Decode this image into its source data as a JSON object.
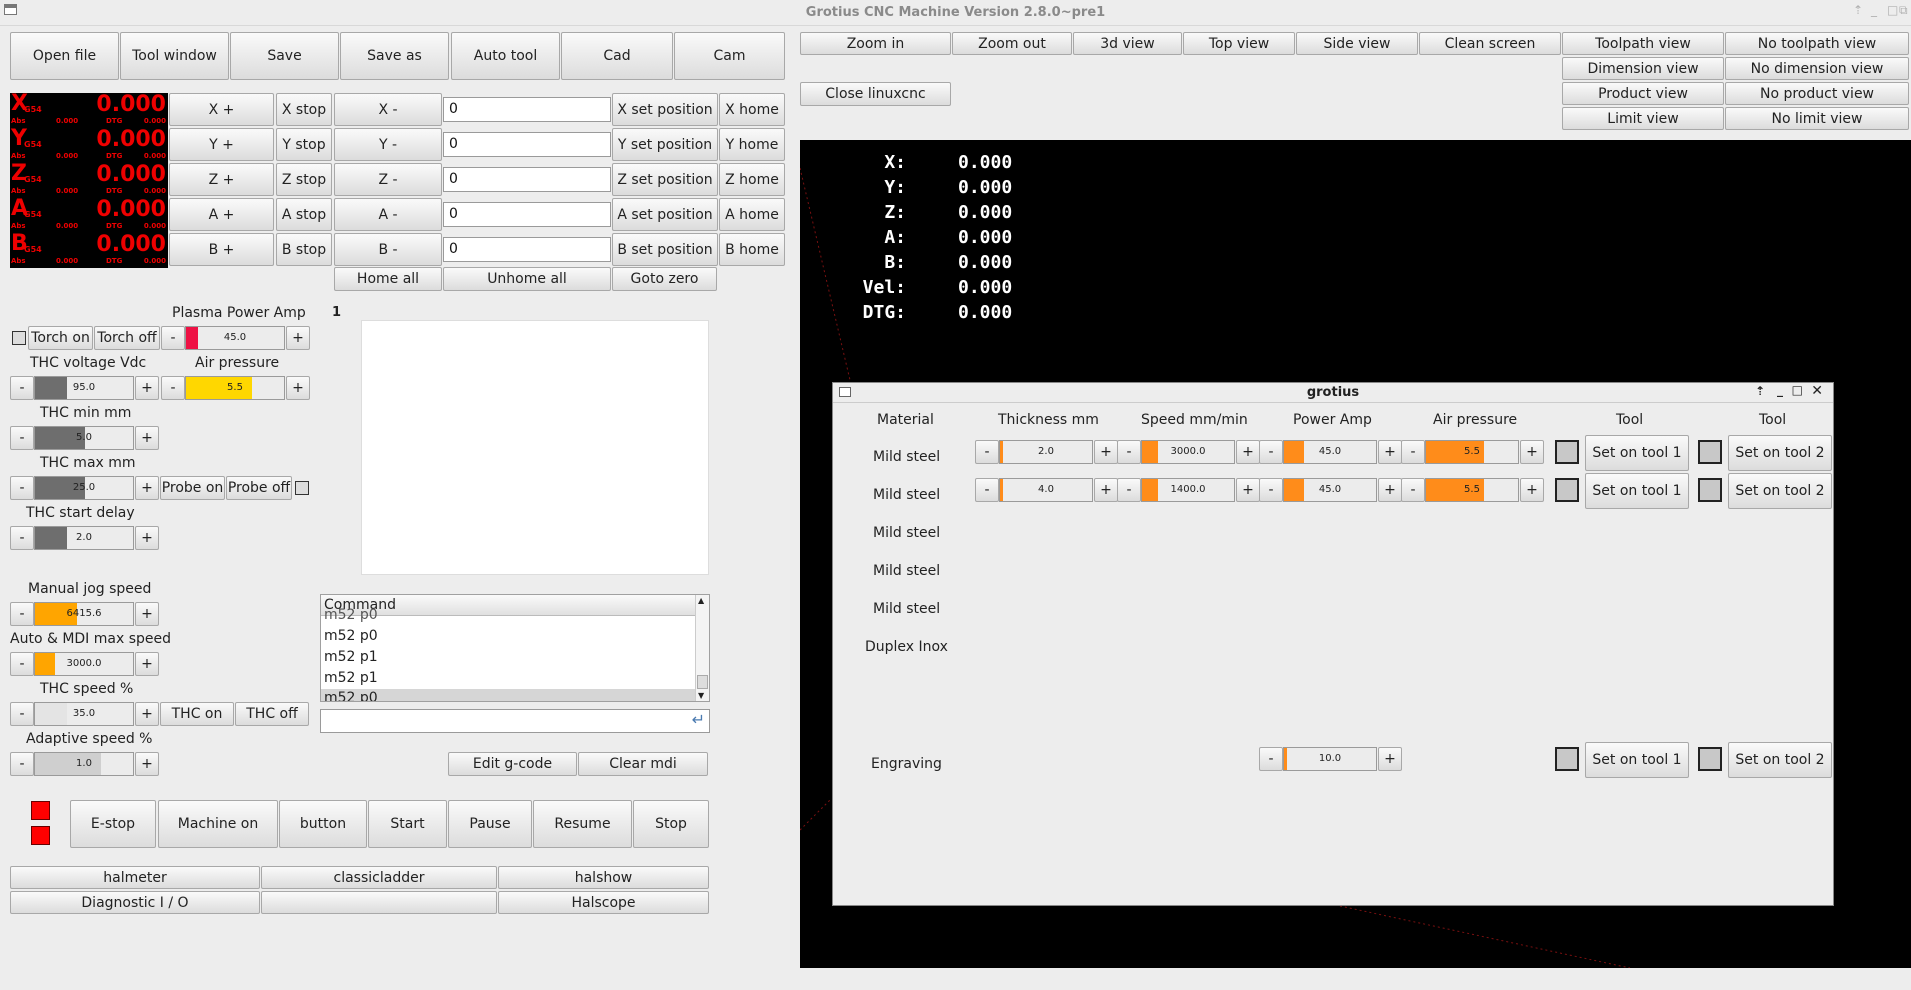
{
  "title": "Grotius CNC Machine Version 2.8.0~pre1",
  "toolbar": [
    "Open file",
    "Tool window",
    "Save",
    "Save as",
    "Auto tool",
    "Cad",
    "Cam"
  ],
  "view_buttons": {
    "zoom_in": "Zoom in",
    "zoom_out": "Zoom out",
    "view_3d": "3d view",
    "top": "Top view",
    "side": "Side view",
    "clean": "Clean screen",
    "close_linuxcnc": "Close linuxcnc",
    "toolpath": "Toolpath view",
    "no_toolpath": "No toolpath view",
    "dimension": "Dimension view",
    "no_dimension": "No dimension view",
    "product": "Product view",
    "no_product": "No product view",
    "limit": "Limit view",
    "no_limit": "No limit view"
  },
  "axes": [
    {
      "name": "X",
      "value": "0.000",
      "abs": "0.000",
      "dtg": "0.000",
      "plus": "X +",
      "stop": "X stop",
      "minus": "X -",
      "input": "0",
      "set": "X set position",
      "home": "X home"
    },
    {
      "name": "Y",
      "value": "0.000",
      "abs": "0.000",
      "dtg": "0.000",
      "plus": "Y +",
      "stop": "Y stop",
      "minus": "Y -",
      "input": "0",
      "set": "Y set position",
      "home": "Y home"
    },
    {
      "name": "Z",
      "value": "0.000",
      "abs": "0.000",
      "dtg": "0.000",
      "plus": "Z +",
      "stop": "Z stop",
      "minus": "Z -",
      "input": "0",
      "set": "Z set position",
      "home": "Z home"
    },
    {
      "name": "A",
      "value": "0.000",
      "abs": "0.000",
      "dtg": "0.000",
      "plus": "A +",
      "stop": "A stop",
      "minus": "A -",
      "input": "0",
      "set": "A set position",
      "home": "A home"
    },
    {
      "name": "B",
      "value": "0.000",
      "abs": "0.000",
      "dtg": "0.000",
      "plus": "B +",
      "stop": "B stop",
      "minus": "B -",
      "input": "0",
      "set": "B set position",
      "home": "B home"
    }
  ],
  "dro_labels": {
    "g54": "G54",
    "abs": "Abs",
    "dtg": "DTG"
  },
  "home_all": "Home all",
  "unhome_all": "Unhome all",
  "goto_zero": "Goto zero",
  "plasma": {
    "power_label": "Plasma Power Amp",
    "torch_on": "Torch on",
    "torch_off": "Torch off",
    "power_value": "45.0",
    "thc_voltage_label": "THC voltage Vdc",
    "thc_voltage_value": "95.0",
    "air_pressure_label": "Air pressure",
    "air_pressure_value": "5.5",
    "thc_min_label": "THC min mm",
    "thc_min_value": "5.0",
    "thc_max_label": "THC max mm",
    "thc_max_value": "25.0",
    "probe_on": "Probe on",
    "probe_off": "Probe off",
    "thc_start_delay_label": "THC start delay",
    "thc_start_delay_value": "2.0"
  },
  "speeds": {
    "manual_jog_label": "Manual jog speed",
    "manual_jog_value": "6415.6",
    "auto_mdi_label": "Auto & MDI max speed",
    "auto_mdi_value": "3000.0",
    "thc_speed_label": "THC speed %",
    "thc_speed_value": "35.0",
    "thc_on": "THC on",
    "thc_off": "THC off",
    "adaptive_label": "Adaptive speed %",
    "adaptive_value": "1.0"
  },
  "preview_number": "1",
  "command": {
    "header": "Command",
    "rows": [
      "m52 p0",
      "m52 p0",
      "m52 p1",
      "m52 p1",
      "m52 p0"
    ],
    "edit_gcode": "Edit g-code",
    "clear_mdi": "Clear mdi"
  },
  "machine": {
    "estop": "E-stop",
    "machine_on": "Machine on",
    "button": "button",
    "start": "Start",
    "pause": "Pause",
    "resume": "Resume",
    "stop": "Stop"
  },
  "tools": {
    "halmeter": "halmeter",
    "classicladder": "classicladder",
    "halshow": "halshow",
    "diagnostic": "Diagnostic I / O",
    "blank": "",
    "halscope": "Halscope"
  },
  "canvas_dro": [
    {
      "label": "X:",
      "value": "0.000"
    },
    {
      "label": "Y:",
      "value": "0.000"
    },
    {
      "label": "Z:",
      "value": "0.000"
    },
    {
      "label": "A:",
      "value": "0.000"
    },
    {
      "label": "B:",
      "value": "0.000"
    },
    {
      "label": "Vel:",
      "value": "0.000"
    },
    {
      "label": "DTG:",
      "value": "0.000"
    }
  ],
  "dialog": {
    "title": "grotius",
    "headers": [
      "Material",
      "Thickness mm",
      "Speed mm/min",
      "Power Amp",
      "Air pressure",
      "Tool",
      "Tool"
    ],
    "rows": [
      {
        "material": "Mild steel",
        "thickness": "2.0",
        "speed": "3000.0",
        "power": "45.0",
        "air": "5.5",
        "tool1": "Set on tool 1",
        "tool2": "Set on tool 2"
      },
      {
        "material": "Mild steel",
        "thickness": "4.0",
        "speed": "1400.0",
        "power": "45.0",
        "air": "5.5",
        "tool1": "Set on tool 1",
        "tool2": "Set on tool 2"
      },
      {
        "material": "Mild steel"
      },
      {
        "material": "Mild steel"
      },
      {
        "material": "Mild steel"
      },
      {
        "material": "Duplex Inox"
      }
    ],
    "engraving": {
      "material": "Engraving",
      "power": "10.0",
      "tool1": "Set on tool 1",
      "tool2": "Set on tool 2"
    }
  },
  "colors": {
    "dro": "#ee0000",
    "accent_orange": "#ff8c1a",
    "air_yellow": "#ffd700",
    "power_red": "#ee1144",
    "slider_grey": "#6e6e6e"
  },
  "slider_levels": {
    "plasma_power": 0.12,
    "thc_voltage": 0.32,
    "air_pressure": 0.66,
    "thc_min": 0.5,
    "thc_max": 0.5,
    "thc_start_delay": 0.32,
    "manual_jog": 0.42,
    "auto_mdi": 0.2,
    "thc_speed": 0.32,
    "adaptive": 0.66
  }
}
